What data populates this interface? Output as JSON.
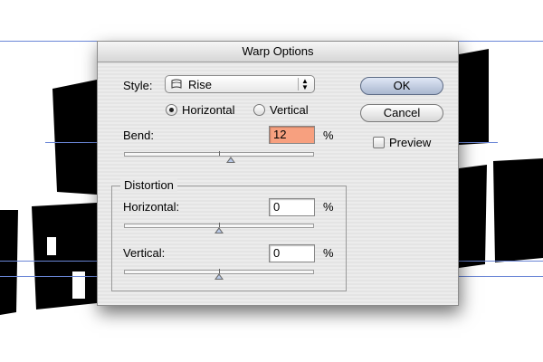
{
  "dialog": {
    "title": "Warp Options",
    "style_label": "Style:",
    "style_value": "Rise",
    "orientation": {
      "horizontal_label": "Horizontal",
      "vertical_label": "Vertical",
      "selected": "Horizontal"
    },
    "bend": {
      "label": "Bend:",
      "value": "12",
      "unit": "%",
      "slider_position": 0.56
    },
    "distortion": {
      "title": "Distortion",
      "horizontal": {
        "label": "Horizontal:",
        "value": "0",
        "unit": "%",
        "slider_position": 0.5
      },
      "vertical": {
        "label": "Vertical:",
        "value": "0",
        "unit": "%",
        "slider_position": 0.5
      }
    },
    "buttons": {
      "ok": "OK",
      "cancel": "Cancel"
    },
    "preview": {
      "label": "Preview",
      "checked": false
    }
  },
  "colors": {
    "highlight_field": "#f7a07f",
    "guide_line": "#6a86d6"
  }
}
